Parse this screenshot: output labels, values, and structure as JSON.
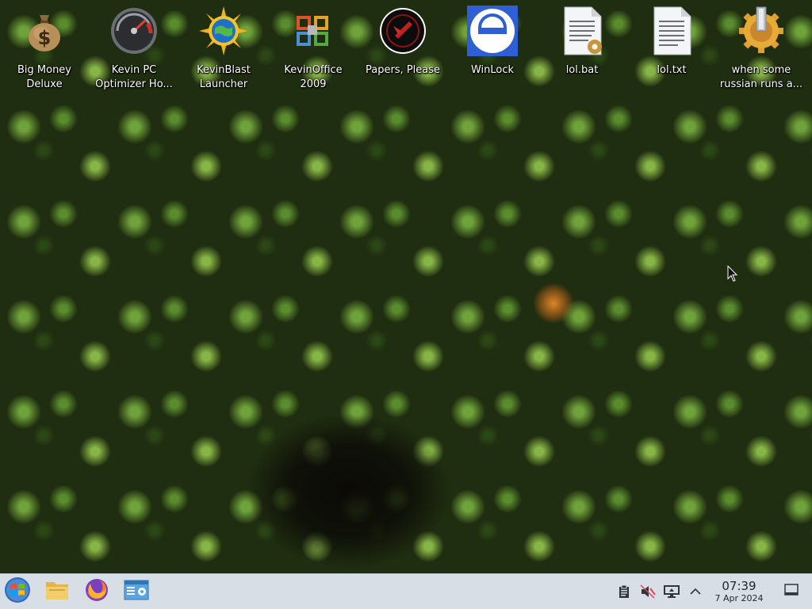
{
  "desktop": {
    "icons": [
      {
        "label": "Big Money\nDeluxe",
        "icon": "money-bag-icon"
      },
      {
        "label": "Kevin PC\nOptimizer Ho...",
        "icon": "speedometer-icon"
      },
      {
        "label": "KevinBlast\nLauncher",
        "icon": "globe-sun-icon"
      },
      {
        "label": "KevinOffice\n2009",
        "icon": "office-icon"
      },
      {
        "label": "Papers, Please",
        "icon": "papers-please-icon"
      },
      {
        "label": "WinLock",
        "icon": "winlock-icon"
      },
      {
        "label": "lol.bat",
        "icon": "batch-file-icon"
      },
      {
        "label": "lol.txt",
        "icon": "text-file-icon"
      },
      {
        "label": "when some\nrussian runs a...",
        "icon": "gear-icon"
      }
    ]
  },
  "taskbar": {
    "launchers": [
      {
        "name": "start-menu-button",
        "icon": "windows-logo-icon"
      },
      {
        "name": "file-manager-button",
        "icon": "folder-icon"
      },
      {
        "name": "firefox-button",
        "icon": "firefox-icon"
      },
      {
        "name": "system-settings-button",
        "icon": "settings-window-icon"
      }
    ],
    "tray": {
      "icons": [
        "clipboard-icon",
        "volume-muted-icon",
        "display-icon",
        "chevron-up-icon"
      ],
      "time": "07:39",
      "date": "7 Apr 2024"
    }
  }
}
